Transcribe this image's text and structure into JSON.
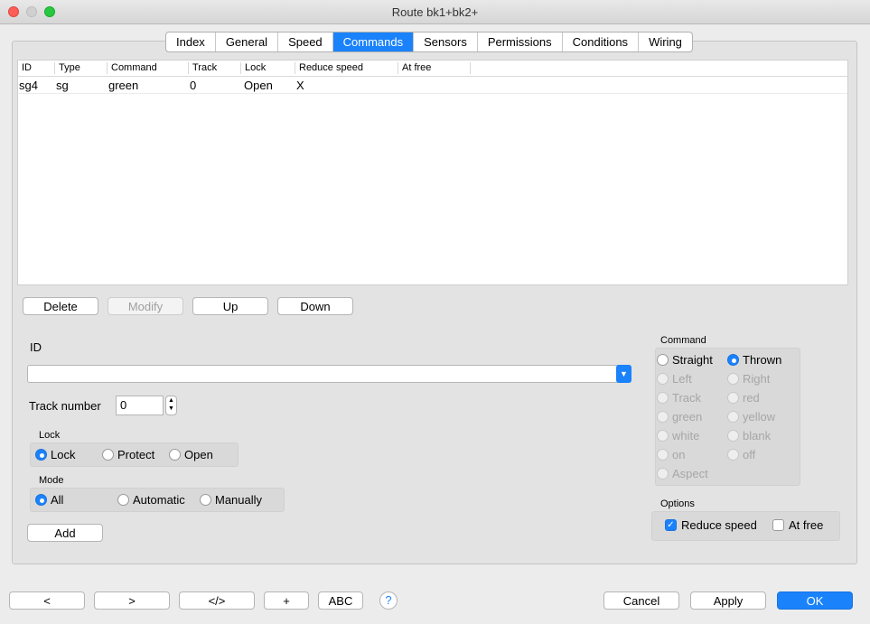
{
  "window": {
    "title": "Route bk1+bk2+"
  },
  "tabs": [
    "Index",
    "General",
    "Speed",
    "Commands",
    "Sensors",
    "Permissions",
    "Conditions",
    "Wiring"
  ],
  "table": {
    "columns": [
      "ID",
      "Type",
      "Command",
      "Track",
      "Lock",
      "Reduce speed",
      "At free"
    ],
    "rows": [
      [
        "sg4",
        "sg",
        "green",
        "0",
        "Open",
        "X",
        ""
      ]
    ]
  },
  "list_buttons": {
    "delete": "Delete",
    "modify": "Modify",
    "up": "Up",
    "down": "Down"
  },
  "form": {
    "id_label": "ID",
    "id_value": "",
    "track_number_label": "Track number",
    "track_number_value": "0",
    "lock_group_label": "Lock",
    "lock_options": [
      "Lock",
      "Protect",
      "Open"
    ],
    "lock_selected": "Lock",
    "mode_group_label": "Mode",
    "mode_options": [
      "All",
      "Automatic",
      "Manually"
    ],
    "mode_selected": "All",
    "add_button": "Add"
  },
  "command": {
    "group_label": "Command",
    "options": [
      "Straight",
      "Thrown",
      "Left",
      "Right",
      "Track",
      "red",
      "green",
      "yellow",
      "white",
      "blank",
      "on",
      "off",
      "Aspect"
    ],
    "selected": "Thrown"
  },
  "options": {
    "group_label": "Options",
    "reduce_speed_label": "Reduce speed",
    "reduce_speed_checked": true,
    "at_free_label": "At free",
    "at_free_checked": false
  },
  "bottom": {
    "prev": "<",
    "next": ">",
    "xml": "</>",
    "plus": "+",
    "abc": "ABC",
    "help": "?",
    "cancel": "Cancel",
    "apply": "Apply",
    "ok": "OK"
  },
  "colors": {
    "accent": "#1a82fb"
  }
}
